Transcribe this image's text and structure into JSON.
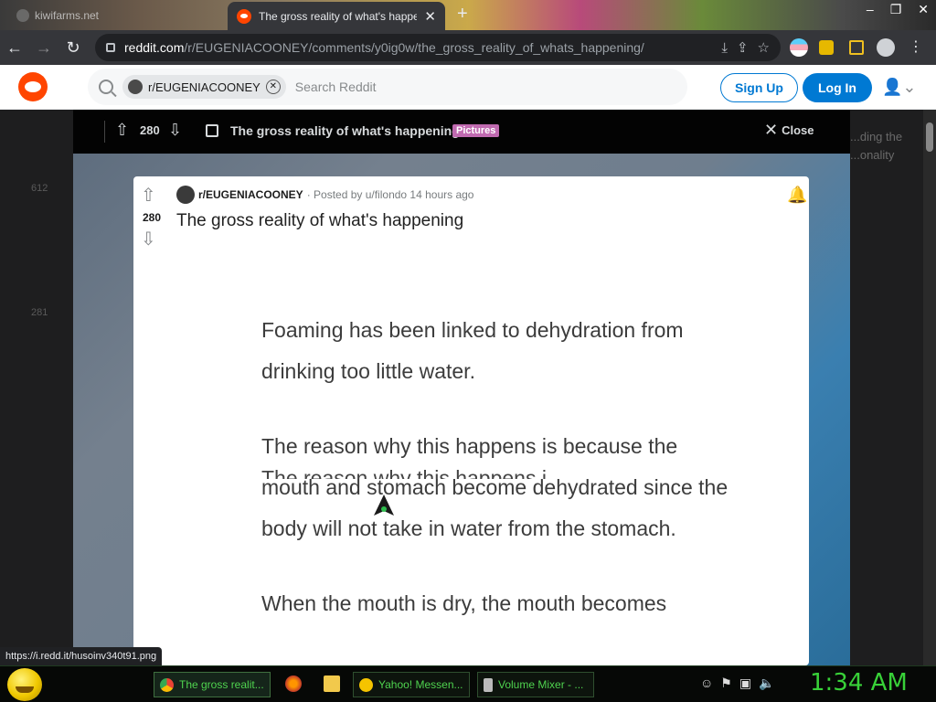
{
  "browser": {
    "inactive_tab_title": "kiwifarms.net",
    "active_tab_title": "The gross reality of what's happening",
    "close_tab_glyph": "✕",
    "new_tab_glyph": "+",
    "url_host": "reddit.com",
    "url_path": "/r/EUGENIACOONEY/comments/y0ig0w/the_gross_reality_of_whats_happening/",
    "status_url": "https://i.redd.it/husoinv340t91.png"
  },
  "reddit_header": {
    "search_chip": "r/EUGENIACOONEY",
    "search_placeholder": "Search Reddit",
    "signup_label": "Sign Up",
    "login_label": "Log In"
  },
  "modal": {
    "score": "280",
    "title": "The gross reality of what's happening",
    "flair": "Pictures",
    "close_label": "Close"
  },
  "post": {
    "subreddit": "r/EUGENIACOONEY",
    "posted_by": "· Posted by u/filondo 14 hours ago",
    "score": "280",
    "title": "The gross reality of what's happening",
    "image_text": {
      "p1": "Foaming has been linked to dehydration from drinking too little water.",
      "p2": "The reason why this happens is because the mouth and stomach become dehydrated since the body will not take in water from the stomach.",
      "p3": "When the mouth is dry, the mouth becomes"
    },
    "ghost_line": "The reason why this happens i"
  },
  "background": {
    "left_counts": [
      "612",
      "281"
    ],
    "right_snippets": [
      "...ding the",
      "...onality"
    ]
  },
  "taskbar": {
    "items": [
      {
        "label": "The gross realit...",
        "icon_color": "#4285f4"
      },
      {
        "label": "Yahoo! Messen...",
        "icon_color": "#f5c400"
      },
      {
        "label": "Volume Mixer - ...",
        "icon_color": "#cccccc"
      }
    ],
    "clock": "1:34 AM"
  },
  "colors": {
    "reddit_orange": "#ff4500",
    "reddit_blue": "#0079d3",
    "flair_pink": "#c06ab0",
    "taskbar_green": "#38d138"
  }
}
